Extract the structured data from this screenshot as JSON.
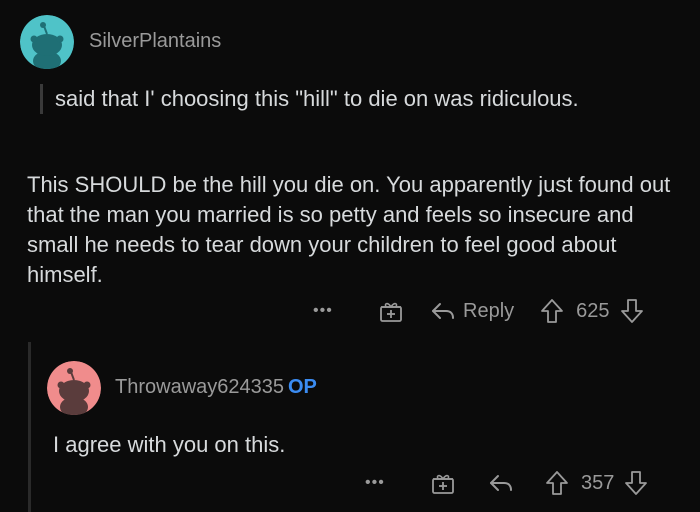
{
  "comment": {
    "username": "SilverPlantains",
    "quote": "said that I' choosing this \"hill\" to die on was ridiculous.",
    "body": "This SHOULD be the hill you die on. You apparently just found out that the man you married is so petty and feels so insecure and small he needs to tear down your children to feel good about himself.",
    "actions": {
      "more": "•••",
      "reply_label": "Reply",
      "votes": "625"
    },
    "avatar_color": "#4fc3c8"
  },
  "reply": {
    "username": "Throwaway624335",
    "op_badge": "OP",
    "body": "I agree with you on this.",
    "actions": {
      "more": "•••",
      "votes": "357"
    },
    "avatar_color": "#f08c8c"
  },
  "colors": {
    "background": "#0b0b0b",
    "text": "#d7dadc",
    "muted": "#9a9a9a",
    "op_blue": "#3b8cf2"
  }
}
